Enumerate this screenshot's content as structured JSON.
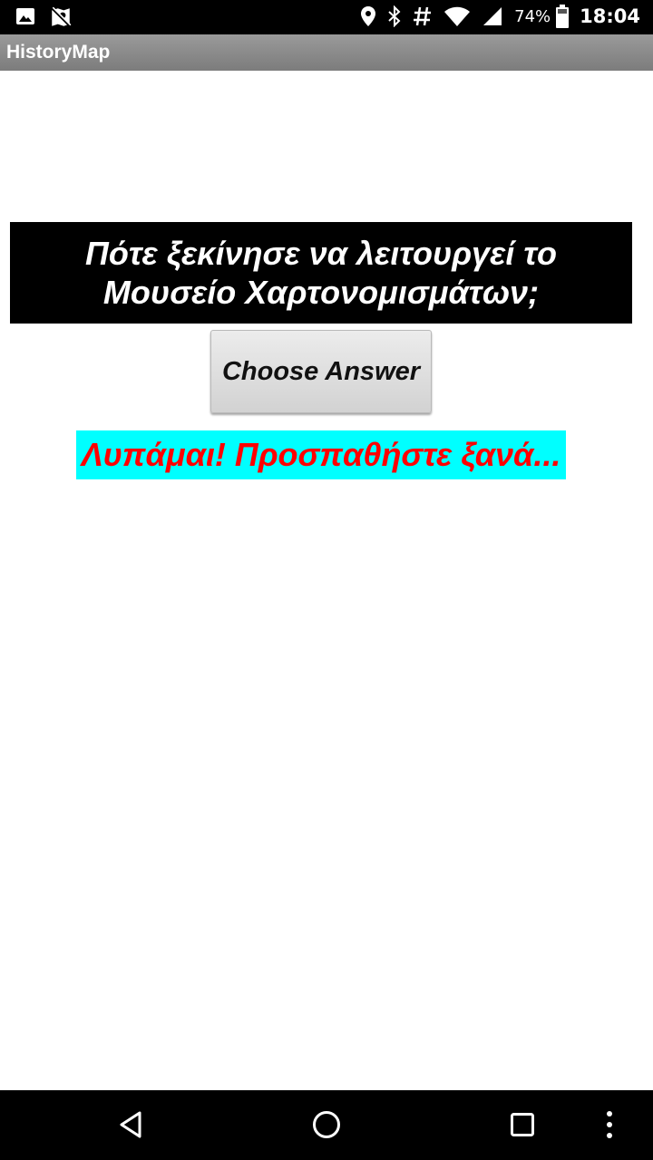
{
  "status_bar": {
    "battery_percent": "74%",
    "time": "18:04",
    "icons": [
      "image-icon",
      "map-off-icon",
      "location-icon",
      "bluetooth-icon",
      "hash-icon",
      "wifi-icon",
      "signal-icon"
    ]
  },
  "app_bar": {
    "title": "HistoryMap"
  },
  "quiz": {
    "question": "Πότε ξεκίνησε να λειτουργεί το Μουσείο Χαρτονομισμάτων;",
    "choose_button_label": "Choose Answer",
    "feedback": "Λυπάμαι! Προσπαθήστε ξανά..."
  },
  "colors": {
    "question_bg": "#000000",
    "question_text": "#ffffff",
    "feedback_bg": "#00ffff",
    "feedback_text": "#ff0000"
  },
  "nav_bar": {
    "icons": [
      "back-icon",
      "home-icon",
      "recents-icon",
      "overflow-menu-icon"
    ]
  }
}
